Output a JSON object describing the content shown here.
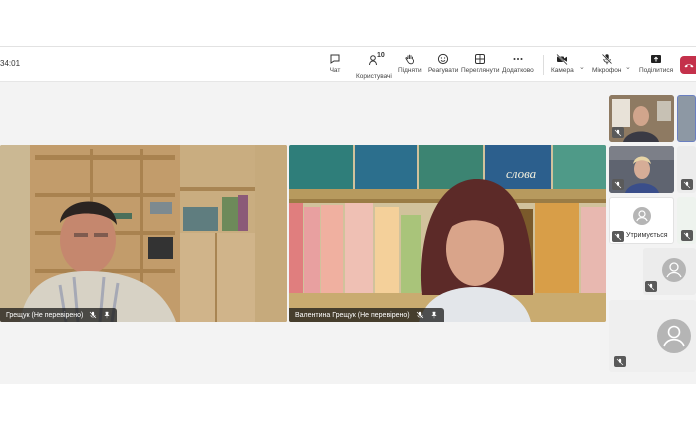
{
  "toolbar": {
    "timer": "34:01",
    "chat": "Чат",
    "people": "Користувачі",
    "people_count": "10",
    "raise": "Підняти",
    "react": "Реагувати",
    "view": "Переглянути",
    "more": "Додатково",
    "camera": "Камера",
    "mic": "Мікрофон",
    "share": "Поділитися"
  },
  "stage": {
    "participant1_name": "Грещук (Не перевірено)",
    "participant2_name": "Валентина Грещук (Не перевірено)",
    "book_title": "слова",
    "hold_label": "Утримується"
  },
  "colors": {
    "leave": "#c4314b",
    "stage_bg": "#f3f3f3"
  }
}
